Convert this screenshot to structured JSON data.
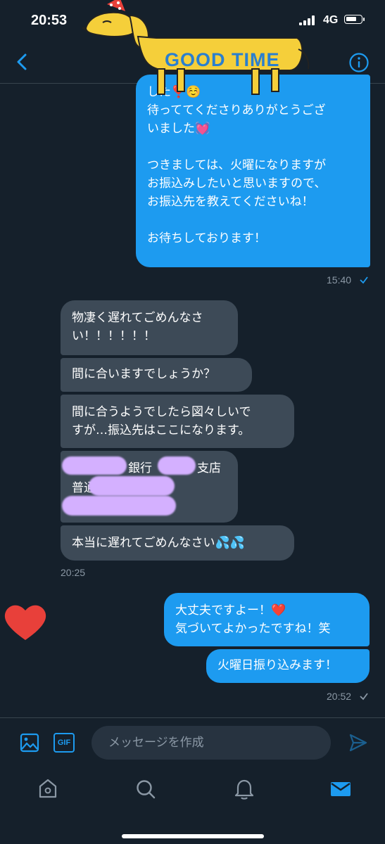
{
  "status": {
    "time": "20:53",
    "network": "4G"
  },
  "sticker": {
    "text": "GOOD TIME"
  },
  "messages": {
    "m1": "した❣️☺️\n待っててくださりありがとうござ\nいました💓\n\nつきましては、火曜になりますが\nお振込みしたいと思いますので、\nお振込先を教えてくださいね！\n\nお待ちしております！",
    "m1_time": "15:40",
    "m2": "物凄く遅れてごめんなさ\nい！！！！！！",
    "m3": "間に合いますでしょうか？",
    "m4": "間に合うようでしたら図々しいで\nすが…振込先はここになります。",
    "m5_bank": "銀行",
    "m5_branch": "支店",
    "m5_type": "普通",
    "m6": "本当に遅れてごめんなさい💦💦",
    "m6_time": "20:25",
    "m7": "大丈夫ですよー！❤️\n気づいてよかったですね！笑",
    "m8": "火曜日振り込みます！",
    "m8_time": "20:52"
  },
  "composer": {
    "placeholder": "メッセージを作成",
    "gif": "GIF"
  },
  "colors": {
    "background": "#15202b",
    "outgoing": "#1d9bf0",
    "incoming": "#3d4a57",
    "accent": "#1d9bf0"
  },
  "icons": [
    "back-icon",
    "info-icon",
    "image-icon",
    "gif-icon",
    "send-icon",
    "home-icon",
    "search-icon",
    "bell-icon",
    "mail-icon",
    "heart-icon",
    "add-reaction-icon"
  ]
}
